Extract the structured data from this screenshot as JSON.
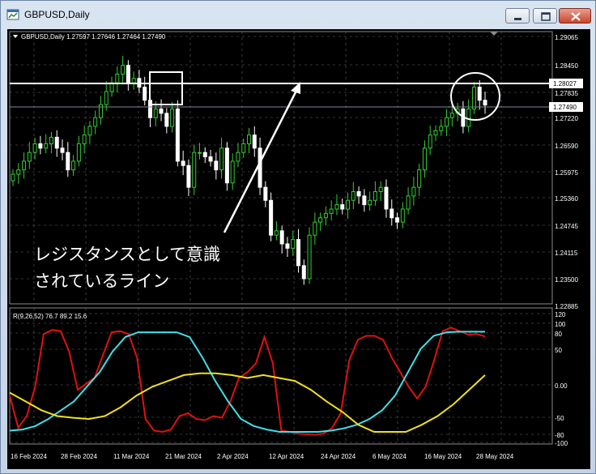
{
  "window": {
    "title": "GBPUSD,Daily"
  },
  "main_chart": {
    "info": "GBPUSD,Daily  1.27597 1.27646 1.27464 1.27490",
    "price_labels": [
      "1.29065",
      "1.28450",
      "1.27835",
      "1.27220",
      "1.26590",
      "1.25975",
      "1.25360",
      "1.24745",
      "1.24115",
      "1.23500",
      "1.22885"
    ],
    "resistance_label": "1.28027",
    "current_label": "1.27490",
    "annotation": [
      "レジスタンスとして意識",
      "されているライン"
    ]
  },
  "indicator": {
    "info": "R(9,26,52) 76.7 89.2 15.6",
    "scale_labels": [
      "120",
      "100",
      "80",
      "50",
      "0.00",
      "-50",
      "-80",
      "-100"
    ]
  },
  "x_axis": {
    "dates": [
      "16 Feb 2024",
      "28 Feb 2024",
      "11 Mar 2024",
      "21 Mar 2024",
      "2 Apr 2024",
      "12 Apr 2024",
      "24 Apr 2024",
      "6 May 2024",
      "16 May 2024",
      "28 May 2024"
    ]
  },
  "colors": {
    "background": "#000000",
    "bull_candle": "#32cd32",
    "bear_candle": "#ffffff",
    "line_red": "#e01010",
    "line_cyan": "#40e0e8",
    "line_yellow": "#f0e020",
    "resistance": "#ffffff",
    "current_price": "#808a99"
  },
  "chart_data": [
    {
      "type": "candlestick",
      "symbol": "GBPUSD",
      "timeframe": "Daily",
      "ylim": [
        1.22885,
        1.29065
      ],
      "resistance": 1.28027,
      "last_close": 1.2749,
      "approx_closes": [
        1.259,
        1.26,
        1.262,
        1.264,
        1.266,
        1.265,
        1.266,
        1.2675,
        1.265,
        1.264,
        1.26,
        1.262,
        1.266,
        1.268,
        1.27,
        1.272,
        1.275,
        1.278,
        1.28,
        1.282,
        1.284,
        1.28,
        1.281,
        1.279,
        1.276,
        1.272,
        1.274,
        1.273,
        1.27,
        1.274,
        1.262,
        1.261,
        1.256,
        1.264,
        1.264,
        1.263,
        1.262,
        1.26,
        1.265,
        1.257,
        1.262,
        1.264,
        1.266,
        1.268,
        1.265,
        1.256,
        1.253,
        1.245,
        1.246,
        1.243,
        1.242,
        1.244,
        1.238,
        1.235,
        1.245,
        1.248,
        1.249,
        1.25,
        1.251,
        1.252,
        1.251,
        1.253,
        1.255,
        1.254,
        1.252,
        1.253,
        1.255,
        1.256,
        1.251,
        1.249,
        1.248,
        1.251,
        1.254,
        1.256,
        1.26,
        1.265,
        1.268,
        1.269,
        1.27,
        1.272,
        1.273,
        1.274,
        1.27,
        1.274,
        1.279,
        1.276,
        1.2749
      ]
    },
    {
      "type": "line",
      "info": "R(9,26,52) 76.7 89.2 15.6",
      "ylim": [
        -100,
        120
      ],
      "series": [
        {
          "color": "red",
          "values": [
            -20,
            -75,
            -55,
            -5,
            85,
            92,
            90,
            55,
            -10,
            0,
            10,
            50,
            88,
            90,
            85,
            45,
            -60,
            -80,
            -82,
            -78,
            -55,
            -50,
            -60,
            -62,
            -55,
            -58,
            -30,
            10,
            20,
            35,
            80,
            35,
            -80,
            -82,
            -85,
            -86,
            -87,
            -85,
            -75,
            -50,
            40,
            75,
            82,
            82,
            75,
            45,
            20,
            -5,
            -25,
            -5,
            40,
            90,
            96,
            90,
            84,
            85,
            81
          ]
        },
        {
          "color": "cyan",
          "values": [
            -80,
            -78,
            -72,
            -60,
            -45,
            -30,
            -5,
            20,
            55,
            80,
            88,
            88,
            88,
            88,
            80,
            45,
            5,
            -30,
            -60,
            -72,
            -78,
            -82,
            -82,
            -82,
            -82,
            -80,
            -76,
            -70,
            -60,
            -45,
            -20,
            20,
            60,
            82,
            88,
            89,
            89,
            89
          ]
        },
        {
          "color": "yellow",
          "values": [
            -15,
            -30,
            -45,
            -55,
            -58,
            -60,
            -55,
            -40,
            -20,
            -5,
            5,
            15,
            18,
            18,
            15,
            10,
            15,
            10,
            5,
            -10,
            -30,
            -48,
            -70,
            -82,
            -82,
            -82,
            -70,
            -55,
            -35,
            -10,
            15
          ]
        }
      ]
    }
  ]
}
